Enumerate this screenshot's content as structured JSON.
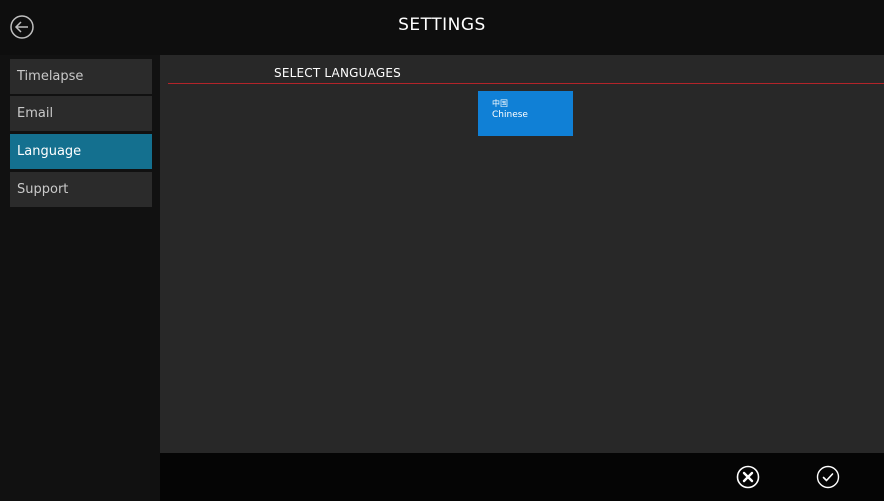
{
  "header": {
    "title": "SETTINGS",
    "back_icon": "back-arrow-circle-icon"
  },
  "sidebar": {
    "items": [
      {
        "label": "Timelapse",
        "active": false
      },
      {
        "label": "Email",
        "active": false
      },
      {
        "label": "Language",
        "active": true
      },
      {
        "label": "Support",
        "active": false
      }
    ]
  },
  "main": {
    "section_title": "SELECT LANGUAGES",
    "languages": [
      {
        "native": "中国",
        "name": "Chinese"
      }
    ]
  },
  "footer": {
    "cancel_icon": "close-circle-icon",
    "confirm_icon": "check-circle-icon"
  },
  "colors": {
    "accent": "#14708f",
    "tile": "#1080d6",
    "divider": "#b3242a"
  }
}
